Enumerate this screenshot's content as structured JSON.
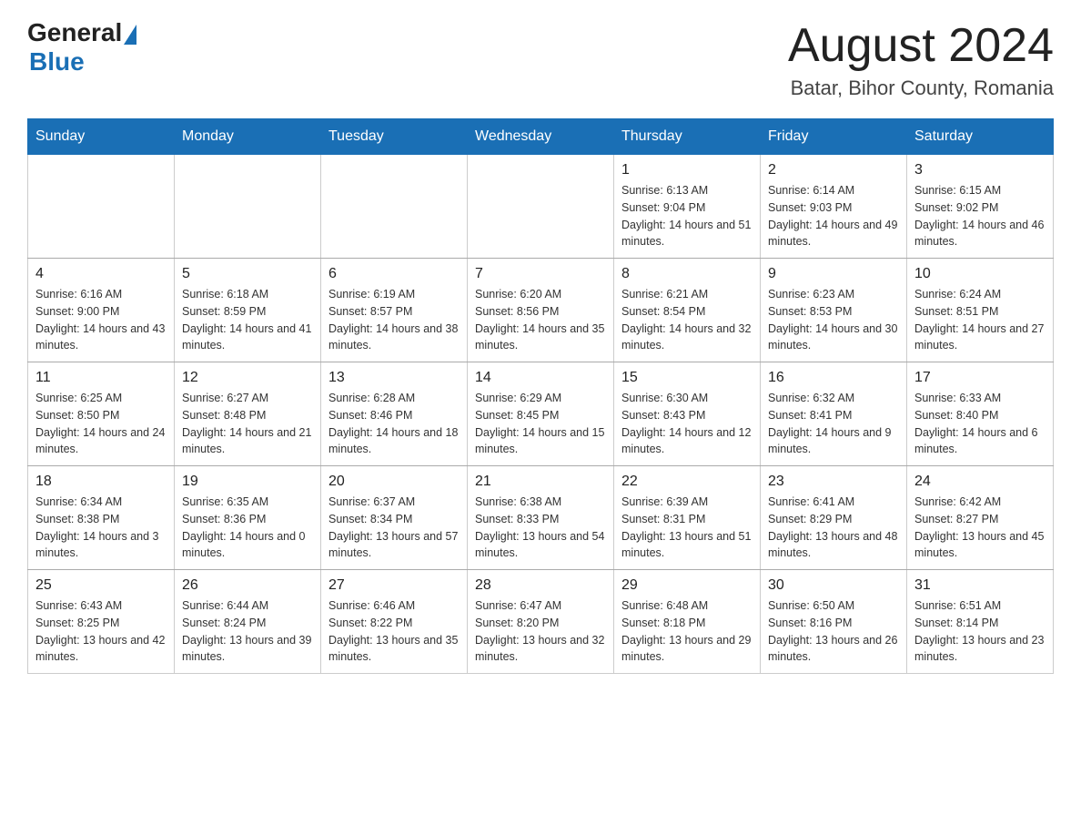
{
  "header": {
    "logo_general": "General",
    "logo_blue": "Blue",
    "title": "August 2024",
    "subtitle": "Batar, Bihor County, Romania"
  },
  "calendar": {
    "headers": [
      "Sunday",
      "Monday",
      "Tuesday",
      "Wednesday",
      "Thursday",
      "Friday",
      "Saturday"
    ],
    "rows": [
      [
        {
          "day": "",
          "info": ""
        },
        {
          "day": "",
          "info": ""
        },
        {
          "day": "",
          "info": ""
        },
        {
          "day": "",
          "info": ""
        },
        {
          "day": "1",
          "info": "Sunrise: 6:13 AM\nSunset: 9:04 PM\nDaylight: 14 hours and 51 minutes."
        },
        {
          "day": "2",
          "info": "Sunrise: 6:14 AM\nSunset: 9:03 PM\nDaylight: 14 hours and 49 minutes."
        },
        {
          "day": "3",
          "info": "Sunrise: 6:15 AM\nSunset: 9:02 PM\nDaylight: 14 hours and 46 minutes."
        }
      ],
      [
        {
          "day": "4",
          "info": "Sunrise: 6:16 AM\nSunset: 9:00 PM\nDaylight: 14 hours and 43 minutes."
        },
        {
          "day": "5",
          "info": "Sunrise: 6:18 AM\nSunset: 8:59 PM\nDaylight: 14 hours and 41 minutes."
        },
        {
          "day": "6",
          "info": "Sunrise: 6:19 AM\nSunset: 8:57 PM\nDaylight: 14 hours and 38 minutes."
        },
        {
          "day": "7",
          "info": "Sunrise: 6:20 AM\nSunset: 8:56 PM\nDaylight: 14 hours and 35 minutes."
        },
        {
          "day": "8",
          "info": "Sunrise: 6:21 AM\nSunset: 8:54 PM\nDaylight: 14 hours and 32 minutes."
        },
        {
          "day": "9",
          "info": "Sunrise: 6:23 AM\nSunset: 8:53 PM\nDaylight: 14 hours and 30 minutes."
        },
        {
          "day": "10",
          "info": "Sunrise: 6:24 AM\nSunset: 8:51 PM\nDaylight: 14 hours and 27 minutes."
        }
      ],
      [
        {
          "day": "11",
          "info": "Sunrise: 6:25 AM\nSunset: 8:50 PM\nDaylight: 14 hours and 24 minutes."
        },
        {
          "day": "12",
          "info": "Sunrise: 6:27 AM\nSunset: 8:48 PM\nDaylight: 14 hours and 21 minutes."
        },
        {
          "day": "13",
          "info": "Sunrise: 6:28 AM\nSunset: 8:46 PM\nDaylight: 14 hours and 18 minutes."
        },
        {
          "day": "14",
          "info": "Sunrise: 6:29 AM\nSunset: 8:45 PM\nDaylight: 14 hours and 15 minutes."
        },
        {
          "day": "15",
          "info": "Sunrise: 6:30 AM\nSunset: 8:43 PM\nDaylight: 14 hours and 12 minutes."
        },
        {
          "day": "16",
          "info": "Sunrise: 6:32 AM\nSunset: 8:41 PM\nDaylight: 14 hours and 9 minutes."
        },
        {
          "day": "17",
          "info": "Sunrise: 6:33 AM\nSunset: 8:40 PM\nDaylight: 14 hours and 6 minutes."
        }
      ],
      [
        {
          "day": "18",
          "info": "Sunrise: 6:34 AM\nSunset: 8:38 PM\nDaylight: 14 hours and 3 minutes."
        },
        {
          "day": "19",
          "info": "Sunrise: 6:35 AM\nSunset: 8:36 PM\nDaylight: 14 hours and 0 minutes."
        },
        {
          "day": "20",
          "info": "Sunrise: 6:37 AM\nSunset: 8:34 PM\nDaylight: 13 hours and 57 minutes."
        },
        {
          "day": "21",
          "info": "Sunrise: 6:38 AM\nSunset: 8:33 PM\nDaylight: 13 hours and 54 minutes."
        },
        {
          "day": "22",
          "info": "Sunrise: 6:39 AM\nSunset: 8:31 PM\nDaylight: 13 hours and 51 minutes."
        },
        {
          "day": "23",
          "info": "Sunrise: 6:41 AM\nSunset: 8:29 PM\nDaylight: 13 hours and 48 minutes."
        },
        {
          "day": "24",
          "info": "Sunrise: 6:42 AM\nSunset: 8:27 PM\nDaylight: 13 hours and 45 minutes."
        }
      ],
      [
        {
          "day": "25",
          "info": "Sunrise: 6:43 AM\nSunset: 8:25 PM\nDaylight: 13 hours and 42 minutes."
        },
        {
          "day": "26",
          "info": "Sunrise: 6:44 AM\nSunset: 8:24 PM\nDaylight: 13 hours and 39 minutes."
        },
        {
          "day": "27",
          "info": "Sunrise: 6:46 AM\nSunset: 8:22 PM\nDaylight: 13 hours and 35 minutes."
        },
        {
          "day": "28",
          "info": "Sunrise: 6:47 AM\nSunset: 8:20 PM\nDaylight: 13 hours and 32 minutes."
        },
        {
          "day": "29",
          "info": "Sunrise: 6:48 AM\nSunset: 8:18 PM\nDaylight: 13 hours and 29 minutes."
        },
        {
          "day": "30",
          "info": "Sunrise: 6:50 AM\nSunset: 8:16 PM\nDaylight: 13 hours and 26 minutes."
        },
        {
          "day": "31",
          "info": "Sunrise: 6:51 AM\nSunset: 8:14 PM\nDaylight: 13 hours and 23 minutes."
        }
      ]
    ]
  }
}
